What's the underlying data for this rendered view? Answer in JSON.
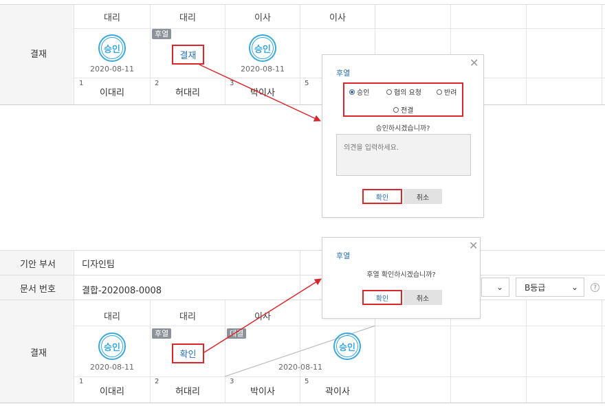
{
  "top": {
    "row_label": "결재",
    "headers": [
      "대리",
      "대리",
      "이사",
      "이사"
    ],
    "cells": [
      {
        "num": "1",
        "name": "이대리",
        "stamp": "승인",
        "date": "2020-08-11"
      },
      {
        "num": "2",
        "name": "허대리",
        "badge": "후열",
        "link": "결재"
      },
      {
        "num": "3",
        "name": "박이사",
        "stamp": "승인",
        "date": "2020-08-11"
      },
      {
        "num": "5",
        "name": ""
      }
    ]
  },
  "dialog1": {
    "title": "후열",
    "options": [
      "승인",
      "협의 요청",
      "반려",
      "전결"
    ],
    "selected": "승인",
    "question": "승인하시겠습니까?",
    "comment_placeholder": "의견을 입력하세요.",
    "ok": "확인",
    "cancel": "취소"
  },
  "bottom": {
    "rows": [
      {
        "label": "기안 부서",
        "value": "디자인팀"
      },
      {
        "label": "문서 번호",
        "value": "결합-202008-0008"
      }
    ],
    "grade_select": "B등급",
    "help_icon": "?",
    "row_label": "결재",
    "headers": [
      "대리",
      "대리",
      "이사",
      ""
    ],
    "cells": [
      {
        "num": "1",
        "name": "이대리",
        "stamp": "승인",
        "date": "2020-08-11"
      },
      {
        "num": "2",
        "name": "허대리",
        "badge": "후열",
        "link": "확인"
      },
      {
        "num": "3",
        "name": "박이사",
        "badge": "대결",
        "date": "2020-08-11"
      },
      {
        "num": "5",
        "name": "곽이사",
        "stamp": "승인"
      }
    ]
  },
  "dialog2": {
    "title": "후열",
    "question": "후열 확인하시겠습니까?",
    "ok": "확인",
    "cancel": "취소"
  },
  "colors": {
    "accent": "#2a6fb0",
    "stamp": "#3aa8d8",
    "highlight": "#d9262d",
    "badge": "#8b9299"
  }
}
